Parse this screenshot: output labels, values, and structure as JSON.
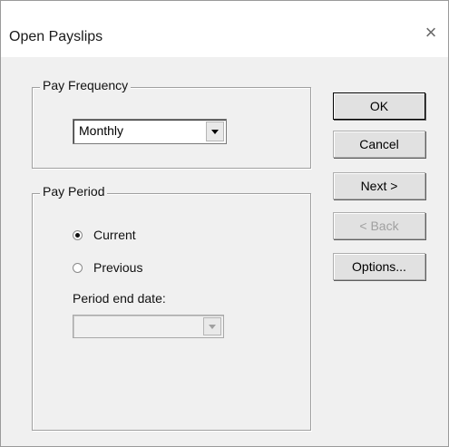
{
  "window": {
    "title": "Open Payslips",
    "close_glyph": "×"
  },
  "pay_frequency": {
    "label": "Pay Frequency",
    "selected": "Monthly"
  },
  "pay_period": {
    "label": "Pay Period",
    "current_label": "Current",
    "previous_label": "Previous",
    "selected": "Current",
    "end_date_label": "Period end date:",
    "end_date_value": ""
  },
  "buttons": {
    "ok": "OK",
    "cancel": "Cancel",
    "next": "Next >",
    "back": "< Back",
    "options": "Options..."
  }
}
